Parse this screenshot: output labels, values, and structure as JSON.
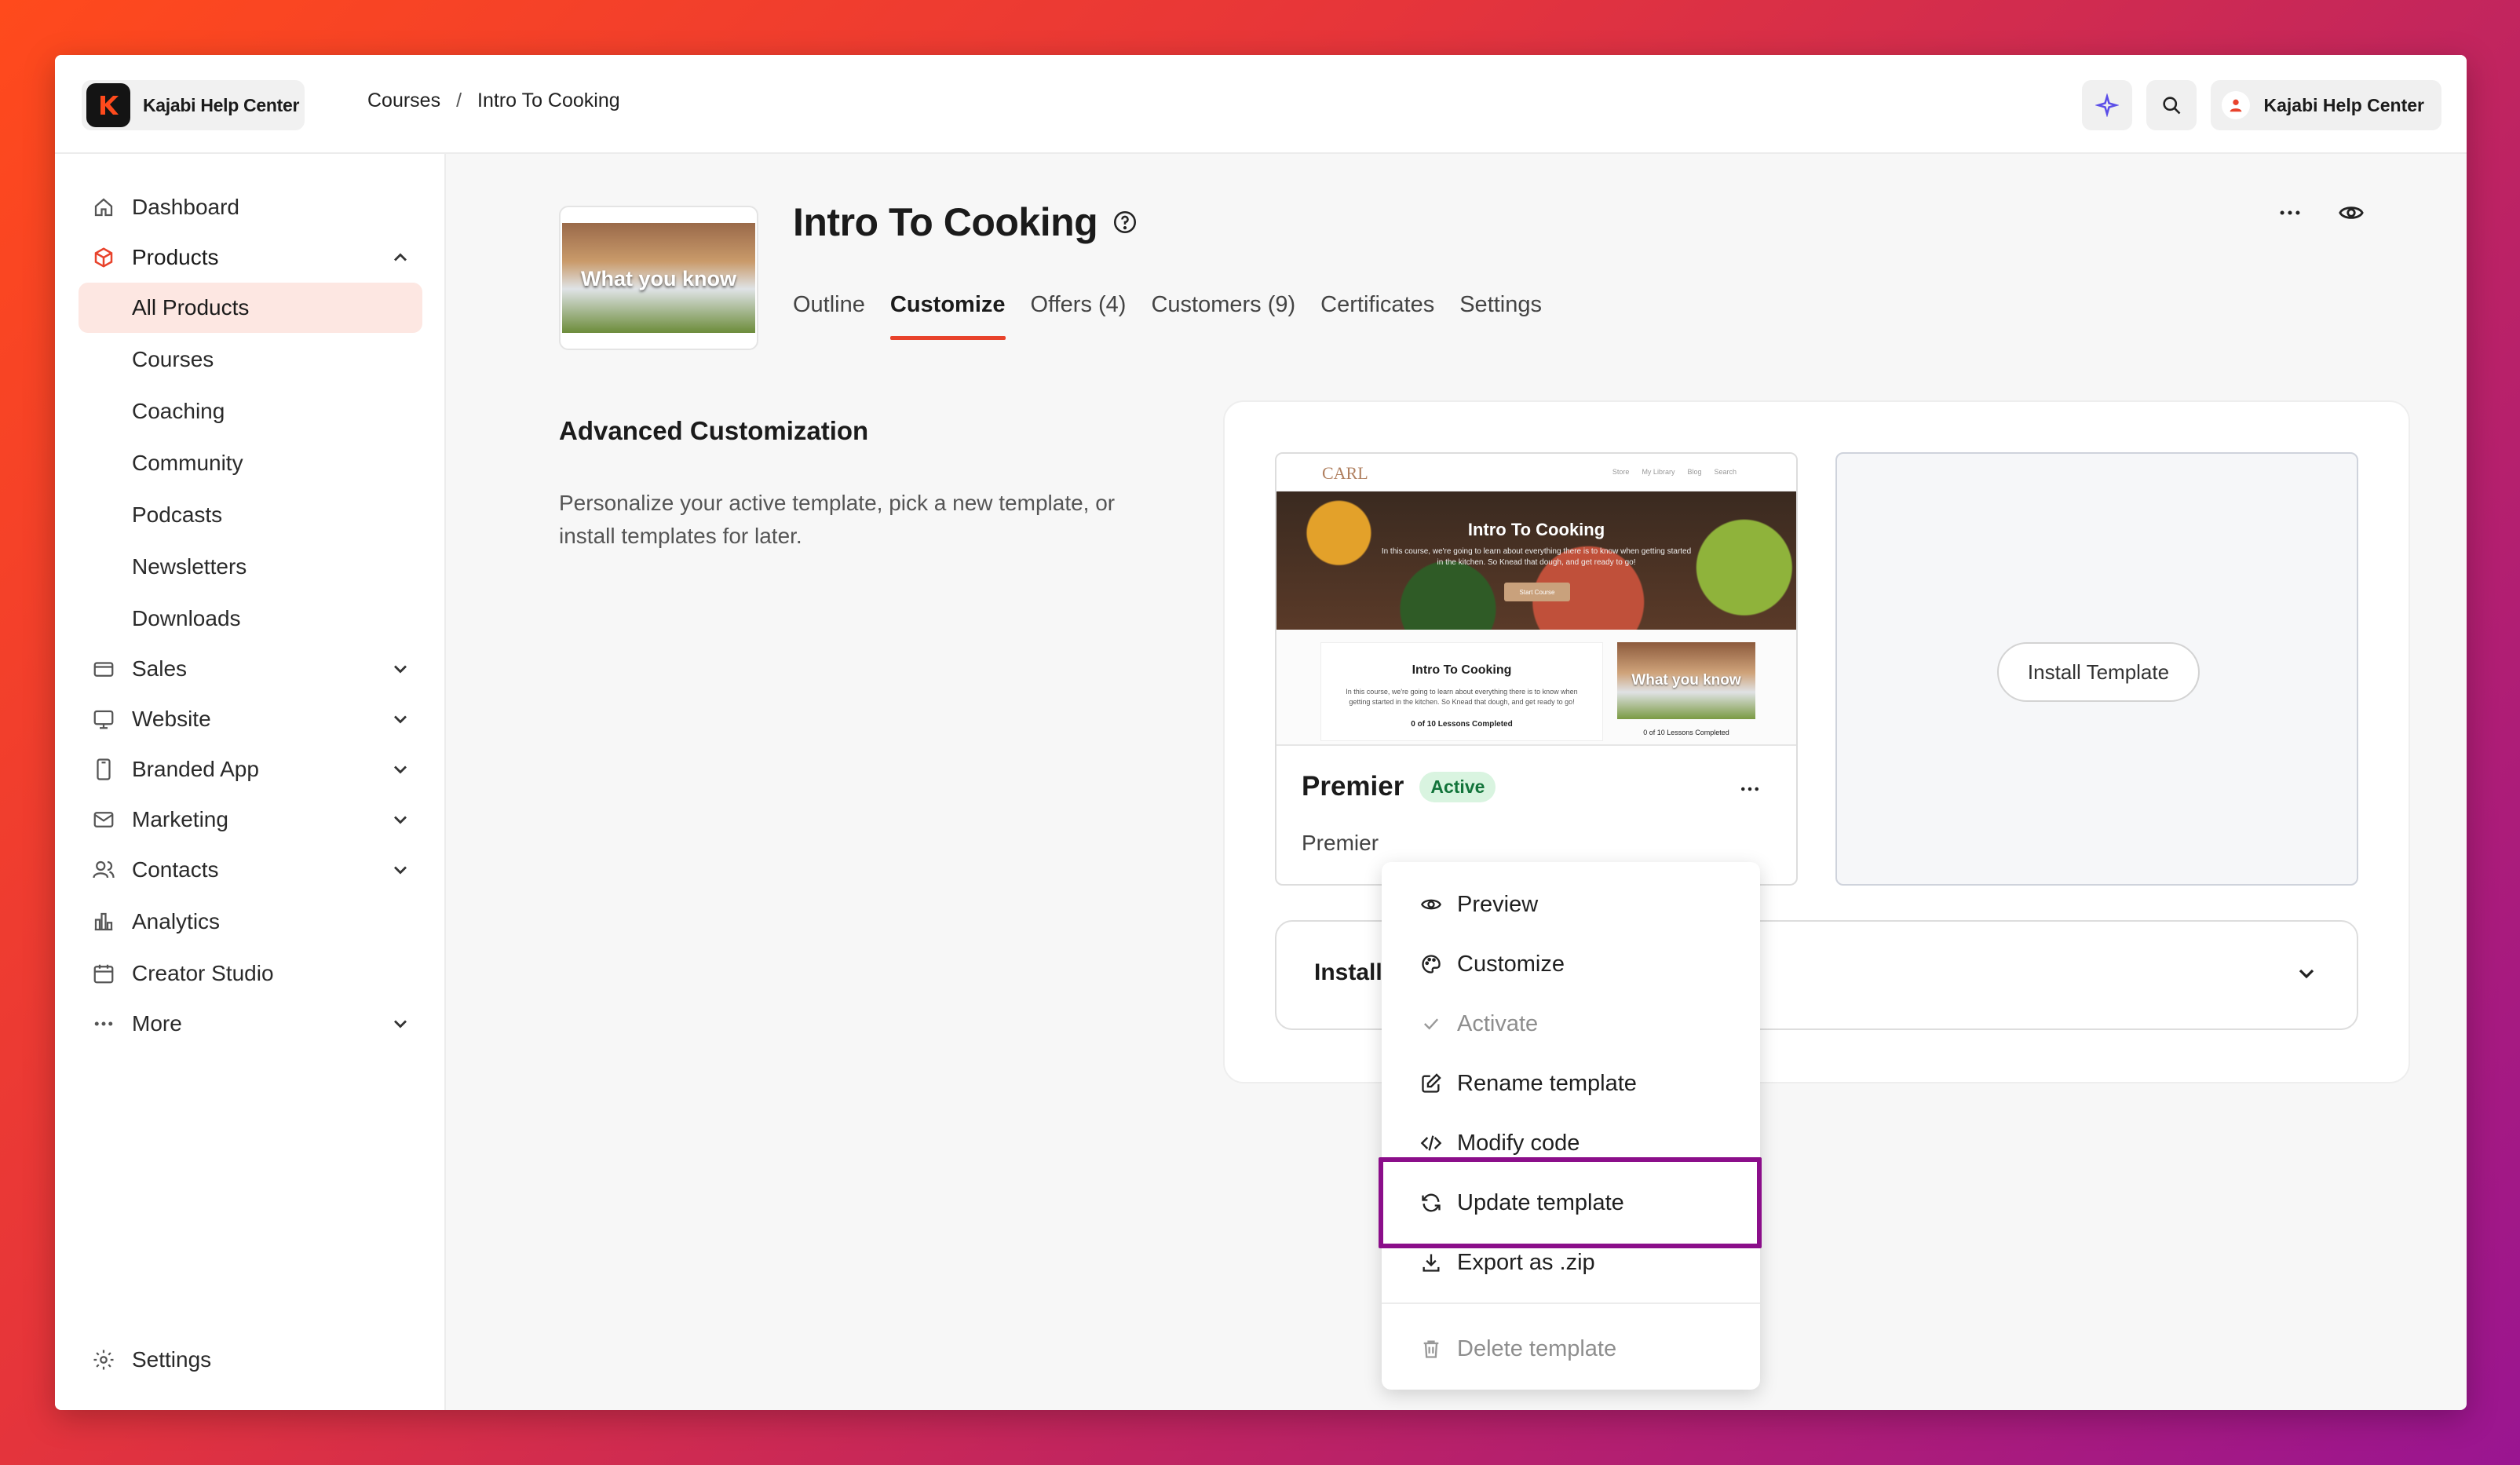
{
  "app": {
    "brand_name": "Kajabi Help Center",
    "breadcrumb": [
      "Courses",
      "Intro To Cooking"
    ],
    "breadcrumb_sep": "/",
    "user_label": "Kajabi Help Center",
    "accent_color": "#e8422b"
  },
  "sidebar": {
    "items": [
      {
        "label": "Dashboard",
        "icon": "home-icon"
      },
      {
        "label": "Products",
        "icon": "box-icon",
        "expanded": true
      },
      {
        "label": "All Products",
        "active": true
      },
      {
        "label": "Courses"
      },
      {
        "label": "Coaching"
      },
      {
        "label": "Community"
      },
      {
        "label": "Podcasts"
      },
      {
        "label": "Newsletters"
      },
      {
        "label": "Downloads"
      },
      {
        "label": "Sales",
        "icon": "credit-card-icon"
      },
      {
        "label": "Website",
        "icon": "monitor-icon"
      },
      {
        "label": "Branded App",
        "icon": "phone-icon"
      },
      {
        "label": "Marketing",
        "icon": "mail-icon"
      },
      {
        "label": "Contacts",
        "icon": "users-icon"
      },
      {
        "label": "Analytics",
        "icon": "bar-chart-icon"
      },
      {
        "label": "Creator Studio",
        "icon": "calendar-icon"
      },
      {
        "label": "More",
        "icon": "dots-icon"
      }
    ],
    "settings_label": "Settings"
  },
  "course": {
    "thumb_caption": "What you know",
    "title": "Intro To Cooking",
    "tabs": [
      {
        "label": "Outline"
      },
      {
        "label": "Customize",
        "active": true
      },
      {
        "label": "Offers (4)"
      },
      {
        "label": "Customers (9)"
      },
      {
        "label": "Certificates"
      },
      {
        "label": "Settings"
      }
    ]
  },
  "customization": {
    "title": "Advanced Customization",
    "description": "Personalize your active template, pick a new template, or install templates for later."
  },
  "template_card": {
    "preview": {
      "logo": "CARL",
      "links": [
        "Store",
        "My Library",
        "Blog",
        "Search"
      ],
      "hero_title": "Intro To Cooking",
      "hero_sub": "In this course, we're going to learn about everything there is to know when getting started in the kitchen. So Knead that dough, and get ready to go!",
      "hero_button": "Start Course",
      "body_title": "Intro To Cooking",
      "body_text": "In this course, we're going to learn about everything there is to know when getting started in the kitchen. So Knead that dough, and get ready to go!",
      "body_lessons": "0 of 10 Lessons Completed",
      "img_caption": "What you know",
      "img_lessons": "0 of 10 Lessons Completed"
    },
    "name": "Premier",
    "status": "Active",
    "description": "Premier"
  },
  "install": {
    "button_label": "Install Template"
  },
  "installed_section": {
    "label": "Installed"
  },
  "context_menu": {
    "items": [
      {
        "label": "Preview",
        "icon": "eye-icon",
        "disabled": false
      },
      {
        "label": "Customize",
        "icon": "palette-icon",
        "disabled": false
      },
      {
        "label": "Activate",
        "icon": "check-icon",
        "disabled": true
      },
      {
        "label": "Rename template",
        "icon": "edit-icon",
        "disabled": false
      },
      {
        "label": "Modify code",
        "icon": "code-icon",
        "disabled": false
      },
      {
        "label": "Update template",
        "icon": "refresh-icon",
        "disabled": false,
        "highlighted": true
      },
      {
        "label": "Export as .zip",
        "icon": "download-icon",
        "disabled": false
      },
      {
        "label": "Delete template",
        "icon": "trash-icon",
        "disabled": true
      }
    ],
    "highlight_color": "#8b0e8a"
  }
}
